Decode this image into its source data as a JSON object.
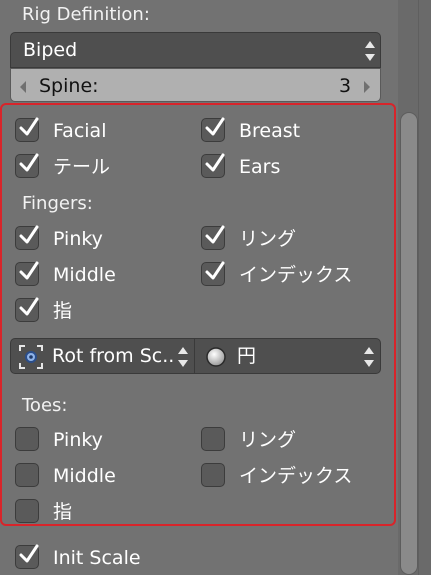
{
  "rig": {
    "section_label": "Rig Definition:",
    "selected": "Biped",
    "spine_label": "Spine:",
    "spine_value": "3"
  },
  "toggles_top": [
    {
      "label": "Facial",
      "checked": true
    },
    {
      "label": "Breast",
      "checked": true
    },
    {
      "label": "テール",
      "checked": true
    },
    {
      "label": "Ears",
      "checked": true
    }
  ],
  "fingers": {
    "label": "Fingers:",
    "items": [
      {
        "label": "Pinky",
        "checked": true
      },
      {
        "label": "リング",
        "checked": true
      },
      {
        "label": "Middle",
        "checked": true
      },
      {
        "label": "インデックス",
        "checked": true
      },
      {
        "label": "指",
        "checked": true
      }
    ]
  },
  "rotation": {
    "mode": "Rot from Sc..",
    "shape": "円"
  },
  "toes": {
    "label": "Toes:",
    "items": [
      {
        "label": "Pinky",
        "checked": false
      },
      {
        "label": "リング",
        "checked": false
      },
      {
        "label": "Middle",
        "checked": false
      },
      {
        "label": "インデックス",
        "checked": false
      },
      {
        "label": "指",
        "checked": false
      }
    ]
  },
  "init_scale": {
    "label": "Init Scale",
    "checked": true
  },
  "colors": {
    "panel_bg": "#727272",
    "highlight": "#d8242a",
    "field_dark": "#4f4f4f"
  }
}
